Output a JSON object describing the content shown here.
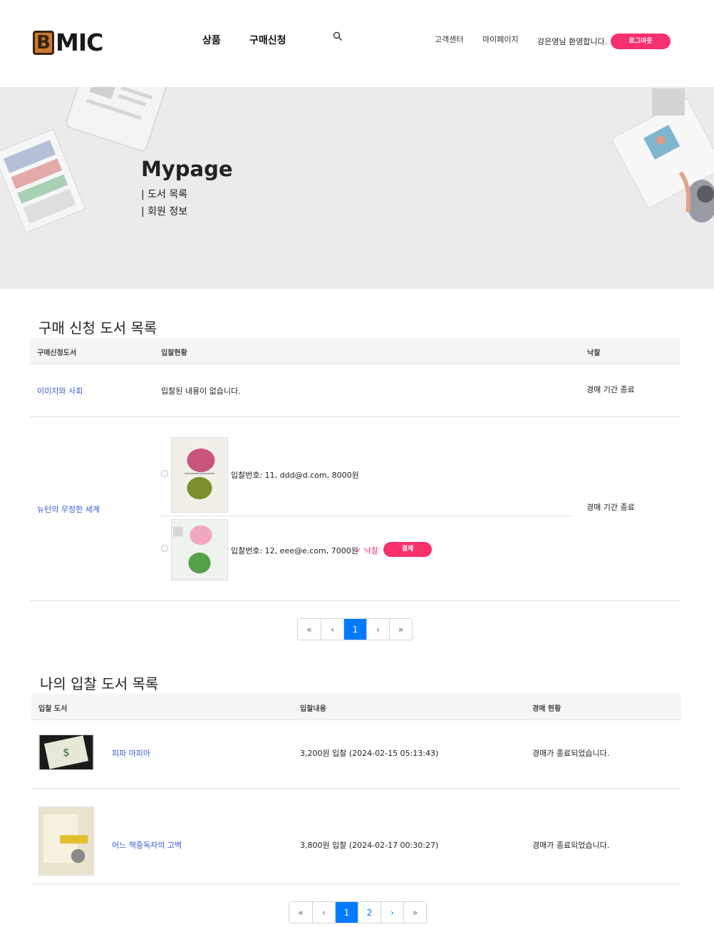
{
  "header": {
    "logo_letter": "B",
    "logo_text": "MIC",
    "nav": [
      "상품",
      "구매신청"
    ],
    "links": [
      "고객센터",
      "마이페이지"
    ],
    "welcome": "강은영님 환영합니다.",
    "logout_label": "로그아웃"
  },
  "hero": {
    "title": "Mypage",
    "links": [
      "| 도서 목록",
      "| 회원 정보"
    ]
  },
  "purchase_section": {
    "title": "구매 신청 도서 목록",
    "headers": [
      "구매신청도서",
      "입찰현황",
      "낙찰"
    ],
    "rows": [
      {
        "book": "이미지와 사회",
        "bid_status": "입찰된 내용이 없습니다.",
        "result": "경매 기간 종료"
      },
      {
        "book": "뉴턴의 무정한 세계",
        "bids": [
          {
            "text": "입찰번호: 11, ddd@d.com, 8000원"
          },
          {
            "text": "입찰번호: 12, eee@e.com, 7000원",
            "win_mark": "✓ 낙찰",
            "pay_label": "결제"
          }
        ],
        "result": "경매 기간 종료"
      }
    ],
    "pagination": {
      "first": "«",
      "prev": "‹",
      "pages": [
        "1"
      ],
      "next": "›",
      "last": "»",
      "current": "1"
    }
  },
  "bid_section": {
    "title": "나의 입찰 도서 목록",
    "headers": [
      "입찰 도서",
      "입찰내용",
      "경매 현황"
    ],
    "rows": [
      {
        "book": "피파 마피아",
        "bid": "3,200원 입찰 (2024-02-15 05:13:43)",
        "status": "경매가 종료되었습니다."
      },
      {
        "book": "어느 책중독자의 고백",
        "bid": "3,800원 입찰 (2024-02-17 00:30:27)",
        "status": "경매가 종료되었습니다."
      }
    ],
    "pagination": {
      "first": "«",
      "prev": "‹",
      "pages": [
        "1",
        "2"
      ],
      "next": "›",
      "last": "»",
      "current": "1"
    }
  },
  "colors": {
    "accent": "#f8306c",
    "link": "#3b5bdb",
    "page_active": "#007bff",
    "hero_bg": "#ebebeb"
  }
}
